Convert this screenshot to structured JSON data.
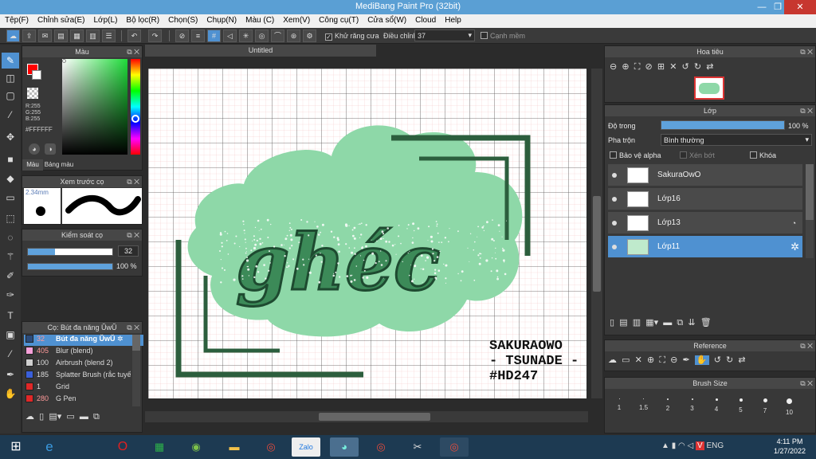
{
  "window": {
    "title": "MediBang Paint Pro (32bit)",
    "min": "—",
    "max": "❐",
    "close": "✕"
  },
  "menu": [
    "Tệp(F)",
    "Chỉnh sửa(E)",
    "Lớp(L)",
    "Bộ lọc(R)",
    "Chọn(S)",
    "Chụp(N)",
    "Màu (C)",
    "Xem(V)",
    "Công cụ(T)",
    "Cửa sổ(W)",
    "Cloud",
    "Help"
  ],
  "toolbar": {
    "antialias_label": "Khử răng cưa",
    "adjust_label": "Điều chỉnh",
    "adjust_value": "37",
    "snap_label": "Cạnh mềm"
  },
  "color_panel": {
    "title": "Màu",
    "r": "R:255",
    "g": "G:255",
    "b": "B:255",
    "hex": "#FFFFFF",
    "tab1": "Màu",
    "tab2": "Bảng màu",
    "fg": "#ff0000",
    "bg": "#ffffff"
  },
  "preview_panel": {
    "title": "Xem trước cọ",
    "size": "2.34mm"
  },
  "brush_control": {
    "title": "Kiểm soát cọ",
    "size_value": "32",
    "opacity_value": "100 %",
    "size_fraction": 0.32,
    "opacity_fraction": 1.0
  },
  "brush_list": {
    "title": "Cọ: Bút đa năng ŬwŬ",
    "items": [
      {
        "size": "32",
        "name": "Bút đa năng ŬwŬ",
        "color": "#2b4b7a"
      },
      {
        "size": "405",
        "name": "Blur (blend)",
        "color": "#f5a0d8"
      },
      {
        "size": "100",
        "name": "Airbrush (blend 2)",
        "color": "#cfcfcf"
      },
      {
        "size": "185",
        "name": "Splatter Brush (rắc tuyết)",
        "color": "#3a5fd9"
      },
      {
        "size": "1",
        "name": "Grid",
        "color": "#e02828"
      },
      {
        "size": "280",
        "name": "G Pen",
        "color": "#e02828"
      }
    ]
  },
  "canvas": {
    "tab": "Untitled",
    "title_art": "ghéc",
    "signature": [
      "SAKURAOWO",
      "- TSUNADE -",
      "#HD247"
    ]
  },
  "navigator": {
    "title": "Hoa tiêu"
  },
  "layer_panel": {
    "title": "Lớp",
    "opacity_label": "Độ trong",
    "opacity_value": "100 %",
    "opacity_fraction": 1.0,
    "blend_label": "Pha trộn",
    "blend_value": "Bình thường",
    "protect_alpha": "Bảo vệ alpha",
    "clipping": "Xén bớt",
    "lock": "Khóa",
    "layers": [
      "SakuraOwO",
      "Lớp16",
      "Lớp13",
      "Lớp11"
    ]
  },
  "reference": {
    "title": "Reference"
  },
  "brush_size": {
    "title": "Brush Size",
    "sizes": [
      "1",
      "1.5",
      "2",
      "3",
      "4",
      "5",
      "7",
      "10"
    ]
  },
  "taskbar": {
    "lang": "ENG",
    "time": "4:11 PM",
    "date": "1/27/2022"
  }
}
